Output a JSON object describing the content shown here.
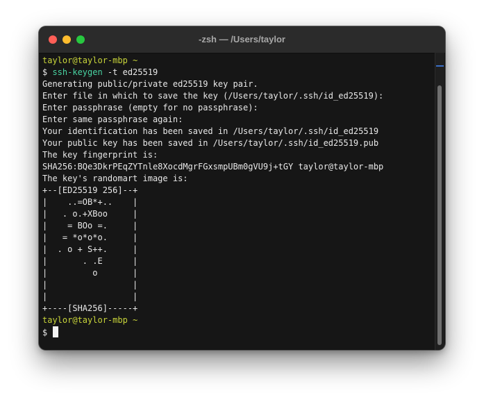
{
  "window": {
    "title": "-zsh — /Users/taylor"
  },
  "traffic_lights": {
    "close": "#ff5f57",
    "minimize": "#febc2e",
    "maximize": "#28c840"
  },
  "terminal": {
    "lines": [
      {
        "kind": "prompt",
        "text": "taylor@taylor-mbp ~"
      },
      {
        "kind": "command",
        "prefix": "$ ",
        "command": "ssh-keygen",
        "args": " -t ed25519"
      },
      {
        "kind": "output",
        "text": "Generating public/private ed25519 key pair."
      },
      {
        "kind": "output",
        "text": "Enter file in which to save the key (/Users/taylor/.ssh/id_ed25519):"
      },
      {
        "kind": "output",
        "text": "Enter passphrase (empty for no passphrase):"
      },
      {
        "kind": "output",
        "text": "Enter same passphrase again:"
      },
      {
        "kind": "output",
        "text": "Your identification has been saved in /Users/taylor/.ssh/id_ed25519"
      },
      {
        "kind": "output",
        "text": "Your public key has been saved in /Users/taylor/.ssh/id_ed25519.pub"
      },
      {
        "kind": "output",
        "text": "The key fingerprint is:"
      },
      {
        "kind": "output",
        "text": "SHA256:BQe3DkrPEqZYTnle8XocdMgrFGxsmpUBm0gVU9j+tGY taylor@taylor-mbp"
      },
      {
        "kind": "output",
        "text": "The key's randomart image is:"
      },
      {
        "kind": "output",
        "text": "+--[ED25519 256]--+"
      },
      {
        "kind": "output",
        "text": "|    ..=OB*+..    |"
      },
      {
        "kind": "output",
        "text": "|   . o.+XBoo     |"
      },
      {
        "kind": "output",
        "text": "|    = BOo =.     |"
      },
      {
        "kind": "output",
        "text": "|   = *o*o*o.     |"
      },
      {
        "kind": "output",
        "text": "|  . o + S++.     |"
      },
      {
        "kind": "output",
        "text": "|       . .E      |"
      },
      {
        "kind": "output",
        "text": "|         o       |"
      },
      {
        "kind": "output",
        "text": "|                 |"
      },
      {
        "kind": "output",
        "text": "|                 |"
      },
      {
        "kind": "output",
        "text": "+----[SHA256]-----+"
      },
      {
        "kind": "prompt",
        "text": "taylor@taylor-mbp ~"
      },
      {
        "kind": "input",
        "prefix": "$ "
      }
    ]
  },
  "colors": {
    "prompt": "#c8d43a",
    "command": "#49d3a2",
    "text": "#e8e8e8",
    "background": "#161616"
  },
  "scrollbar": {
    "position_fraction": 1.0
  }
}
